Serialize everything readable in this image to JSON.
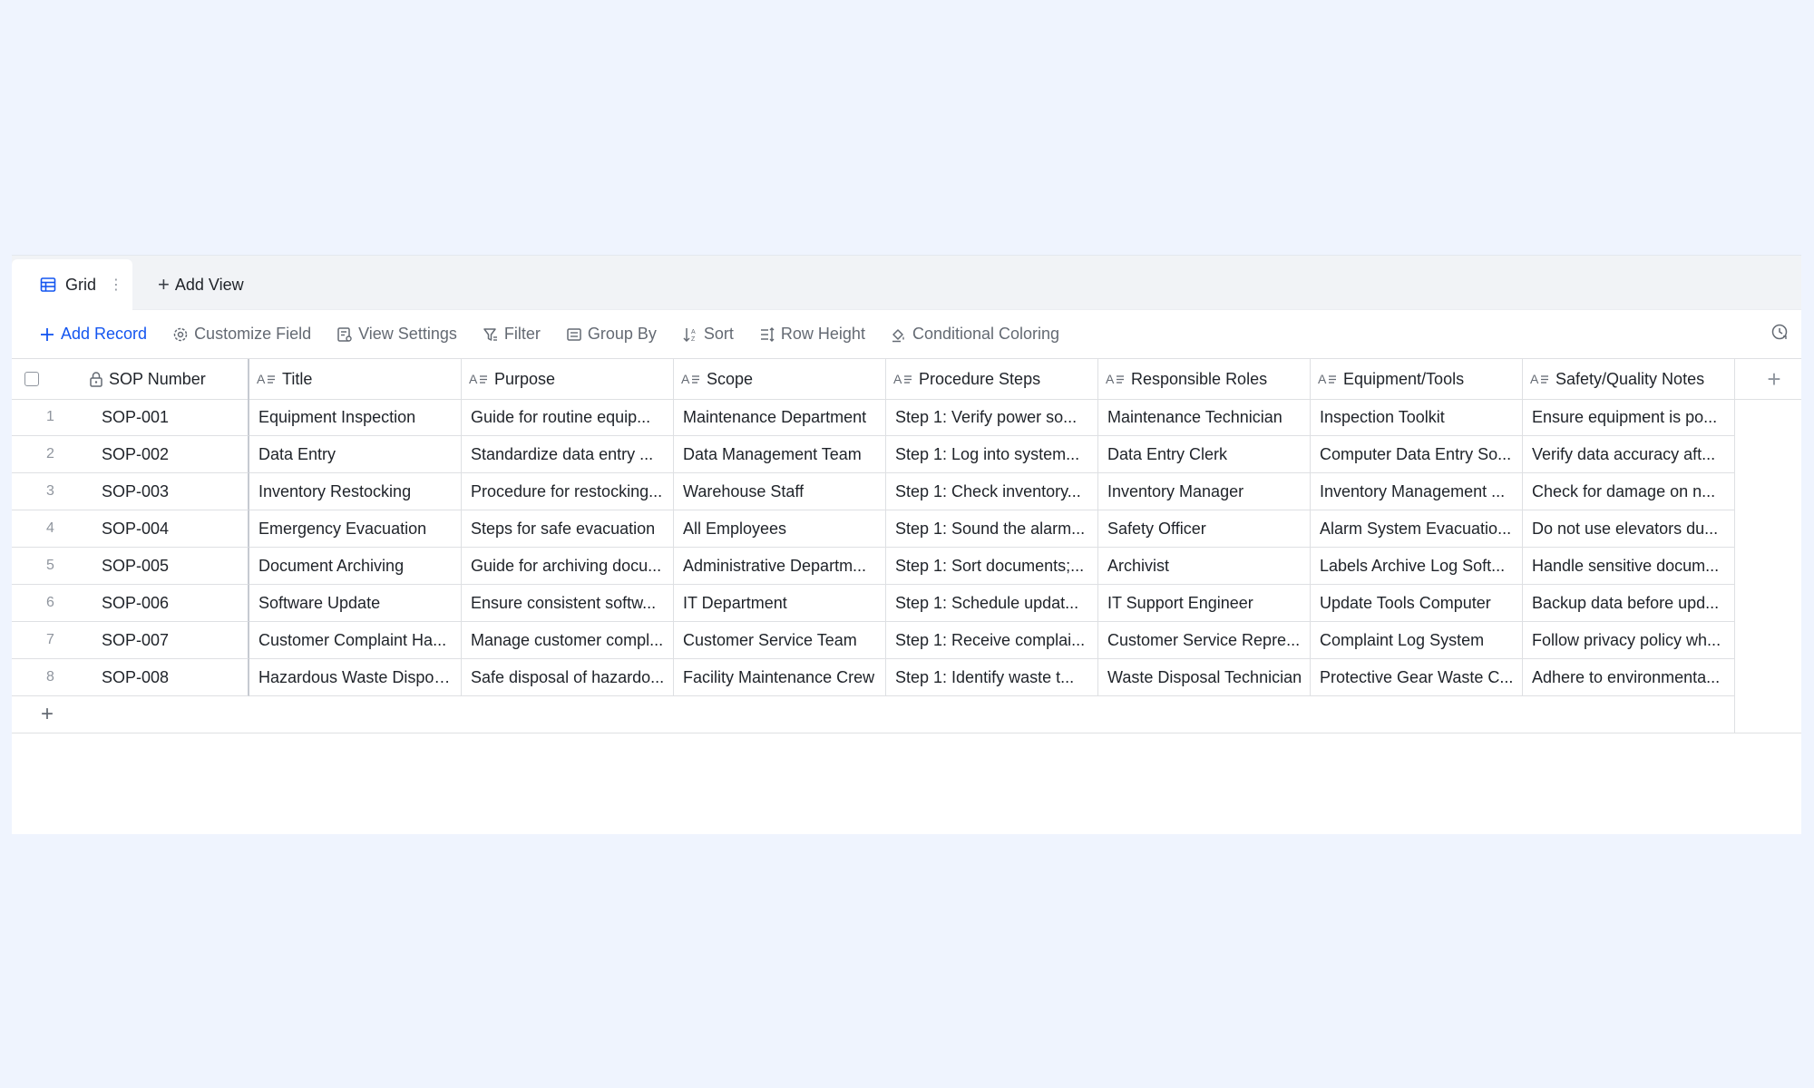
{
  "tabs": {
    "grid_label": "Grid",
    "add_view_label": "Add View"
  },
  "toolbar": {
    "add_record": "Add Record",
    "customize_field": "Customize Field",
    "view_settings": "View Settings",
    "filter": "Filter",
    "group_by": "Group By",
    "sort": "Sort",
    "row_height": "Row Height",
    "conditional_coloring": "Conditional Coloring"
  },
  "columns": [
    {
      "label": "SOP Number"
    },
    {
      "label": "Title"
    },
    {
      "label": "Purpose"
    },
    {
      "label": "Scope"
    },
    {
      "label": "Procedure Steps"
    },
    {
      "label": "Responsible Roles"
    },
    {
      "label": "Equipment/Tools"
    },
    {
      "label": "Safety/Quality Notes"
    }
  ],
  "rows": [
    {
      "idx": "1",
      "cells": [
        "SOP-001",
        "Equipment Inspection",
        "Guide for routine equip...",
        "Maintenance Department",
        "Step 1: Verify power so...",
        "Maintenance Technician",
        "Inspection Toolkit",
        "Ensure equipment is po..."
      ]
    },
    {
      "idx": "2",
      "cells": [
        "SOP-002",
        "Data Entry",
        "Standardize data entry ...",
        "Data Management Team",
        "Step 1: Log into system...",
        "Data Entry Clerk",
        "Computer Data Entry So...",
        "Verify data accuracy aft..."
      ]
    },
    {
      "idx": "3",
      "cells": [
        "SOP-003",
        "Inventory Restocking",
        "Procedure for restocking...",
        "Warehouse Staff",
        "Step 1: Check inventory...",
        "Inventory Manager",
        "Inventory Management ...",
        "Check for damage on n..."
      ]
    },
    {
      "idx": "4",
      "cells": [
        "SOP-004",
        "Emergency Evacuation",
        "Steps for safe evacuation",
        "All Employees",
        "Step 1: Sound the alarm...",
        "Safety Officer",
        "Alarm System Evacuatio...",
        "Do not use elevators du..."
      ]
    },
    {
      "idx": "5",
      "cells": [
        "SOP-005",
        "Document Archiving",
        "Guide for archiving docu...",
        "Administrative Departm...",
        "Step 1: Sort documents;...",
        "Archivist",
        "Labels Archive Log Soft...",
        "Handle sensitive docum..."
      ]
    },
    {
      "idx": "6",
      "cells": [
        "SOP-006",
        "Software Update",
        "Ensure consistent softw...",
        "IT Department",
        "Step 1: Schedule updat...",
        "IT Support Engineer",
        "Update Tools Computer",
        "Backup data before upd..."
      ]
    },
    {
      "idx": "7",
      "cells": [
        "SOP-007",
        "Customer Complaint Ha...",
        "Manage customer compl...",
        "Customer Service Team",
        "Step 1: Receive complai...",
        "Customer Service Repre...",
        "Complaint Log System",
        "Follow privacy policy wh..."
      ]
    },
    {
      "idx": "8",
      "cells": [
        "SOP-008",
        "Hazardous Waste Disposal",
        "Safe disposal of hazardo...",
        "Facility Maintenance Crew",
        "Step 1: Identify waste t...",
        "Waste Disposal Technician",
        "Protective Gear Waste C...",
        "Adhere to environmenta..."
      ]
    }
  ],
  "colors": {
    "accent": "#1456f0",
    "background": "#eff4fe",
    "border": "#dee0e3"
  }
}
